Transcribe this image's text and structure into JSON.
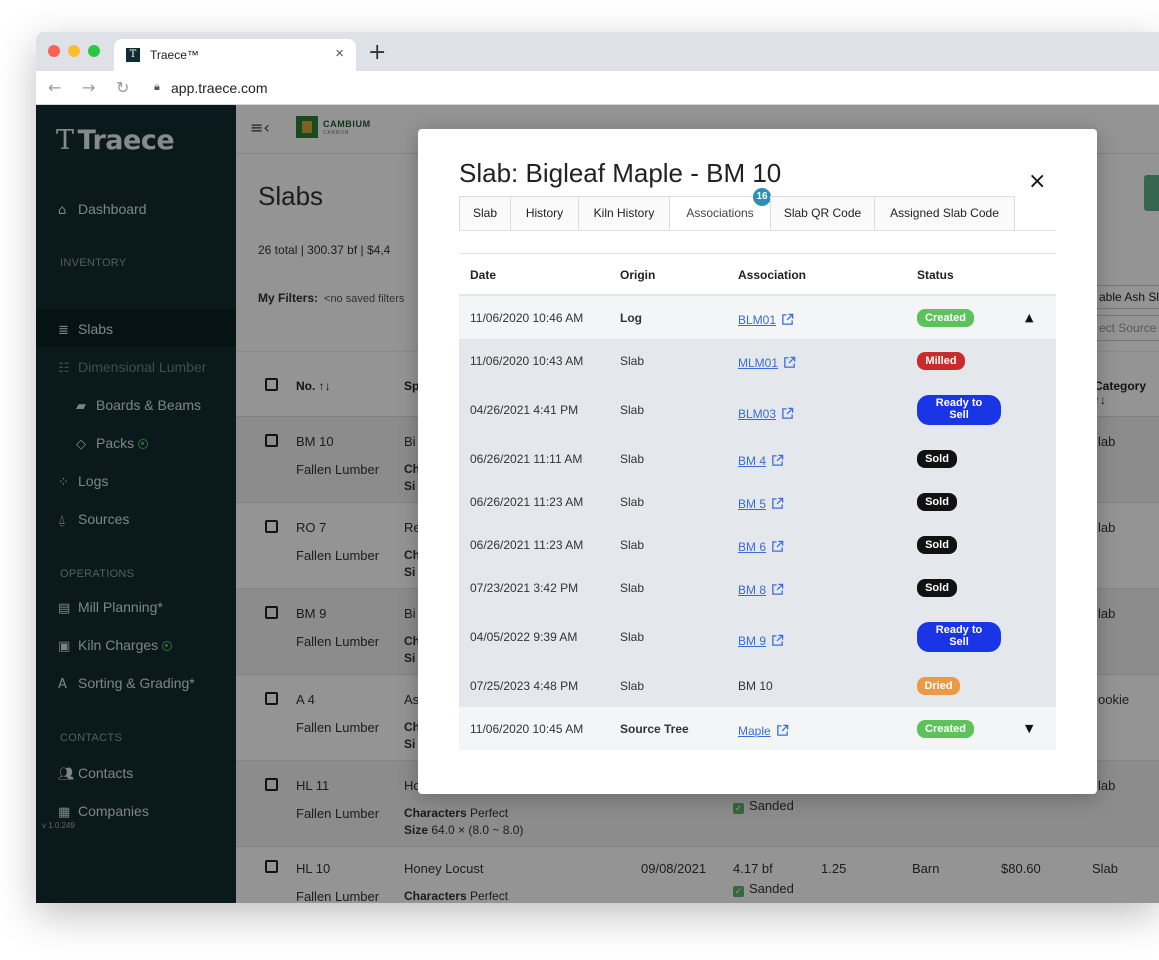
{
  "browser": {
    "tab_title": "Traece™",
    "tab_close": "×",
    "new_tab": "+",
    "url": "app.traece.com"
  },
  "sidebar": {
    "logo": "Traece",
    "items": [
      {
        "label": "Dashboard",
        "icon": "home-icon"
      },
      {
        "label": "Slabs",
        "icon": "list-icon"
      },
      {
        "label": "Dimensional Lumber",
        "icon": "lumber-icon"
      },
      {
        "label": "Boards & Beams",
        "icon": "beams-icon"
      },
      {
        "label": "Packs",
        "icon": "packs-icon"
      },
      {
        "label": "Logs",
        "icon": "logs-icon"
      },
      {
        "label": "Sources",
        "icon": "sources-icon"
      },
      {
        "label": "Mill Planning*",
        "icon": "clipboard-icon"
      },
      {
        "label": "Kiln Charges",
        "icon": "kiln-icon"
      },
      {
        "label": "Sorting & Grading*",
        "icon": "grading-icon"
      },
      {
        "label": "Contacts",
        "icon": "people-icon"
      },
      {
        "label": "Companies",
        "icon": "building-icon"
      }
    ],
    "sections": {
      "inventory": "INVENTORY",
      "operations": "OPERATIONS",
      "contacts": "CONTACTS"
    },
    "version": "v 1.0.249"
  },
  "header": {
    "brand": "CAMBIUM",
    "brand_sub": "CARBON"
  },
  "page": {
    "title": "Slabs",
    "summary": "26 total  |  300.37 bf  |  $4,4",
    "filters_label": "My Filters:",
    "filters_placeholder": "<no saved filters",
    "right_filter_1": "able Ash Sl",
    "right_filter_2": "ect Source",
    "columns": {
      "no": "No. ↑↓",
      "species": "Sp",
      "category": "Category ↑↓"
    },
    "rows": [
      {
        "no": "BM 10",
        "source": "Fallen Lumber",
        "species": "Bi",
        "l2": "Ch",
        "l3": "Si",
        "category": "lab"
      },
      {
        "no": "RO 7",
        "source": "Fallen Lumber",
        "species": "Re",
        "l2": "Ch",
        "l3": "Si",
        "category": "lab"
      },
      {
        "no": "BM 9",
        "source": "Fallen Lumber",
        "species": "Bi",
        "l2": "Ch",
        "l3": "Si",
        "category": "lab"
      },
      {
        "no": "A 4",
        "source": "Fallen Lumber",
        "species": "As",
        "l2": "Ch",
        "l3": "Si",
        "category": "ookie"
      },
      {
        "no": "HL 11",
        "source": "Fallen Lumber",
        "species": "Ho",
        "l2b": "Characters",
        "l2": " Perfect",
        "l3b": "Size",
        "l3": " 64.0 × (8.0 ~ 8.0)",
        "sanded": "Sanded",
        "category": "lab"
      },
      {
        "no": "HL 10",
        "source": "Fallen Lumber",
        "species": "Honey Locust",
        "l2b": "Characters",
        "l2": " Perfect",
        "date": "09/08/2021",
        "bf": "4.17 bf",
        "sanded": "Sanded",
        "thick": "1.25",
        "loc": "Barn",
        "price": "$80.60",
        "category": "Slab"
      }
    ]
  },
  "modal": {
    "title": "Slab: Bigleaf Maple - BM 10",
    "close": "×",
    "tabs": [
      {
        "label": "Slab"
      },
      {
        "label": "History"
      },
      {
        "label": "Kiln History"
      },
      {
        "label": "Associations",
        "badge": "16"
      },
      {
        "label": "Slab QR Code"
      },
      {
        "label": "Assigned Slab Code"
      }
    ],
    "columns": {
      "date": "Date",
      "origin": "Origin",
      "association": "Association",
      "status": "Status"
    },
    "rows": [
      {
        "date": "11/06/2020 10:46 AM",
        "origin": "Log",
        "association": "BLM01",
        "link": true,
        "status": "Created"
      },
      {
        "date": "11/06/2020 10:43 AM",
        "origin": "Slab",
        "association": "MLM01",
        "link": true,
        "status": "Milled"
      },
      {
        "date": "04/26/2021 4:41 PM",
        "origin": "Slab",
        "association": "BLM03",
        "link": true,
        "status": "Ready to Sell"
      },
      {
        "date": "06/26/2021 11:11 AM",
        "origin": "Slab",
        "association": "BM 4",
        "link": true,
        "status": "Sold"
      },
      {
        "date": "06/26/2021 11:23 AM",
        "origin": "Slab",
        "association": "BM 5",
        "link": true,
        "status": "Sold"
      },
      {
        "date": "06/26/2021 11:23 AM",
        "origin": "Slab",
        "association": "BM 6",
        "link": true,
        "status": "Sold"
      },
      {
        "date": "07/23/2021 3:42 PM",
        "origin": "Slab",
        "association": "BM 8",
        "link": true,
        "status": "Sold"
      },
      {
        "date": "04/05/2022 9:39 AM",
        "origin": "Slab",
        "association": "BM 9",
        "link": true,
        "status": "Ready to Sell"
      },
      {
        "date": "07/25/2023 4:48 PM",
        "origin": "Slab",
        "association": "BM 10",
        "link": false,
        "status": "Dried"
      },
      {
        "date": "11/06/2020 10:45 AM",
        "origin": "Source Tree",
        "association": "Maple",
        "link": true,
        "status": "Created"
      }
    ],
    "status_colors": {
      "Created": "#5cc35a",
      "Milled": "#cc2b2b",
      "Ready to Sell": "#1a35e6",
      "Sold": "#111111",
      "Dried": "#ea9a44"
    }
  }
}
